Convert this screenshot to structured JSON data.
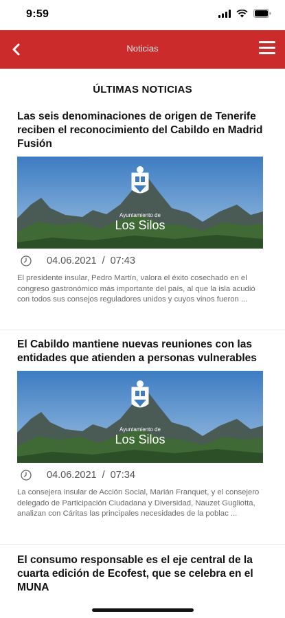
{
  "status": {
    "time": "9:59"
  },
  "header": {
    "title": "Noticias"
  },
  "section_title": "ÚLTIMAS NOTICIAS",
  "image_caption": {
    "line1": "Ayuntamiento de",
    "line2": "Los Silos"
  },
  "news": [
    {
      "title": "Las seis denominaciones de origen de Tenerife reciben el reconocimiento del Cabildo en Madrid Fusión",
      "date": "04.06.2021",
      "time": "07:43",
      "excerpt": "El presidente insular, Pedro Martín, valora el éxito cosechado en el congreso gastronómico más importante del país, al que la isla acudió con todos sus consejos reguladores unidos y cuyos vinos fueron ..."
    },
    {
      "title": "El Cabildo mantiene nuevas reuniones con las entidades que atienden a personas vulnerables",
      "date": "04.06.2021",
      "time": "07:34",
      "excerpt": "La consejera insular de Acción Social, Marián Franquet, y el consejero delegado de Participación Ciudadana y Diversidad, Nauzet Gugliotta, analizan con Cáritas las principales necesidades de la poblac ..."
    },
    {
      "title": "El consumo responsable es el eje central de la cuarta edición de Ecofest, que se celebra en el MUNA"
    }
  ],
  "date_separator": "/",
  "colors": {
    "header_bg": "#cc2b2b",
    "text": "#111111",
    "meta": "#555555"
  }
}
